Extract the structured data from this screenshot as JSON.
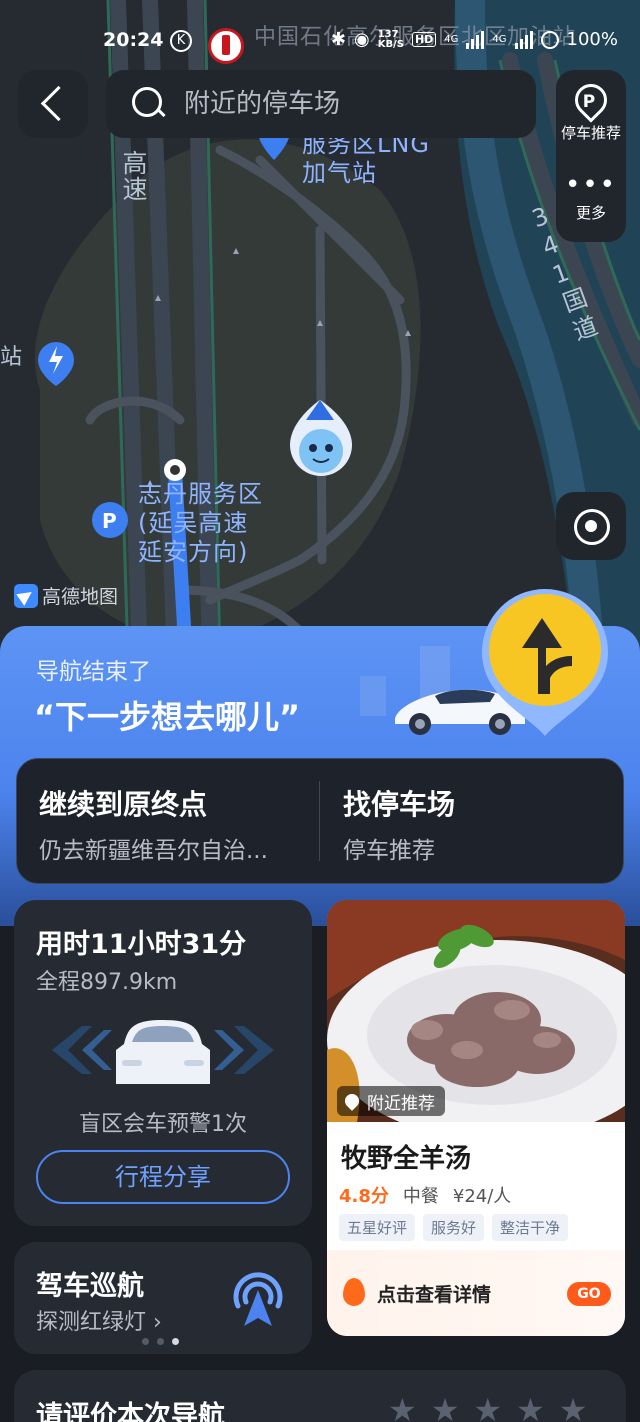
{
  "status_bar": {
    "time": "20:24",
    "k_badge": "K",
    "net_speed": "137\nKB/S",
    "hd_badge": "HD",
    "net_type_1": "4G",
    "net_type_2": "4G",
    "battery": "100%"
  },
  "search": {
    "placeholder": "附近的停车场"
  },
  "side_panel": {
    "parking_label": "停车推荐",
    "more_label": "更多"
  },
  "map": {
    "labels": {
      "sinopec_station": "中国石化高尔服务区北区加油站",
      "lng_station": "服务区LNG\n加气站",
      "highway_left": "高速",
      "road_right": "341国道",
      "left_edge": "站",
      "service_area": "志丹服务区\n(延吴高速\n延安方向)"
    },
    "logo_text": "高德地图"
  },
  "nav_end": {
    "status": "导航结束了",
    "question": "“下一步想去哪儿”"
  },
  "actions": {
    "continue": {
      "title": "继续到原终点",
      "subtitle": "仍去新疆维吾尔自治..."
    },
    "parking": {
      "title": "找停车场",
      "subtitle": "停车推荐"
    }
  },
  "trip": {
    "duration": "用时11小时31分",
    "distance": "全程897.9km",
    "warning": "盲区会车预警1次",
    "share_label": "行程分享"
  },
  "cruise": {
    "title": "驾车巡航",
    "subtitle": "探测红绿灯 ›"
  },
  "restaurant": {
    "badge": "附近推荐",
    "name": "牧野全羊汤",
    "rating": "4.8分",
    "cuisine": "中餐",
    "price": "¥24/人",
    "tags": [
      "五星好评",
      "服务好",
      "整洁干净"
    ],
    "detail_label": "点击查看详情",
    "go_label": "GO"
  },
  "rate": {
    "title": "请评价本次导航"
  },
  "colors": {
    "accent_blue": "#4c83ee",
    "route_blue": "#3d8bff",
    "orange": "#ff6a1a",
    "card_bg": "#252a33"
  }
}
